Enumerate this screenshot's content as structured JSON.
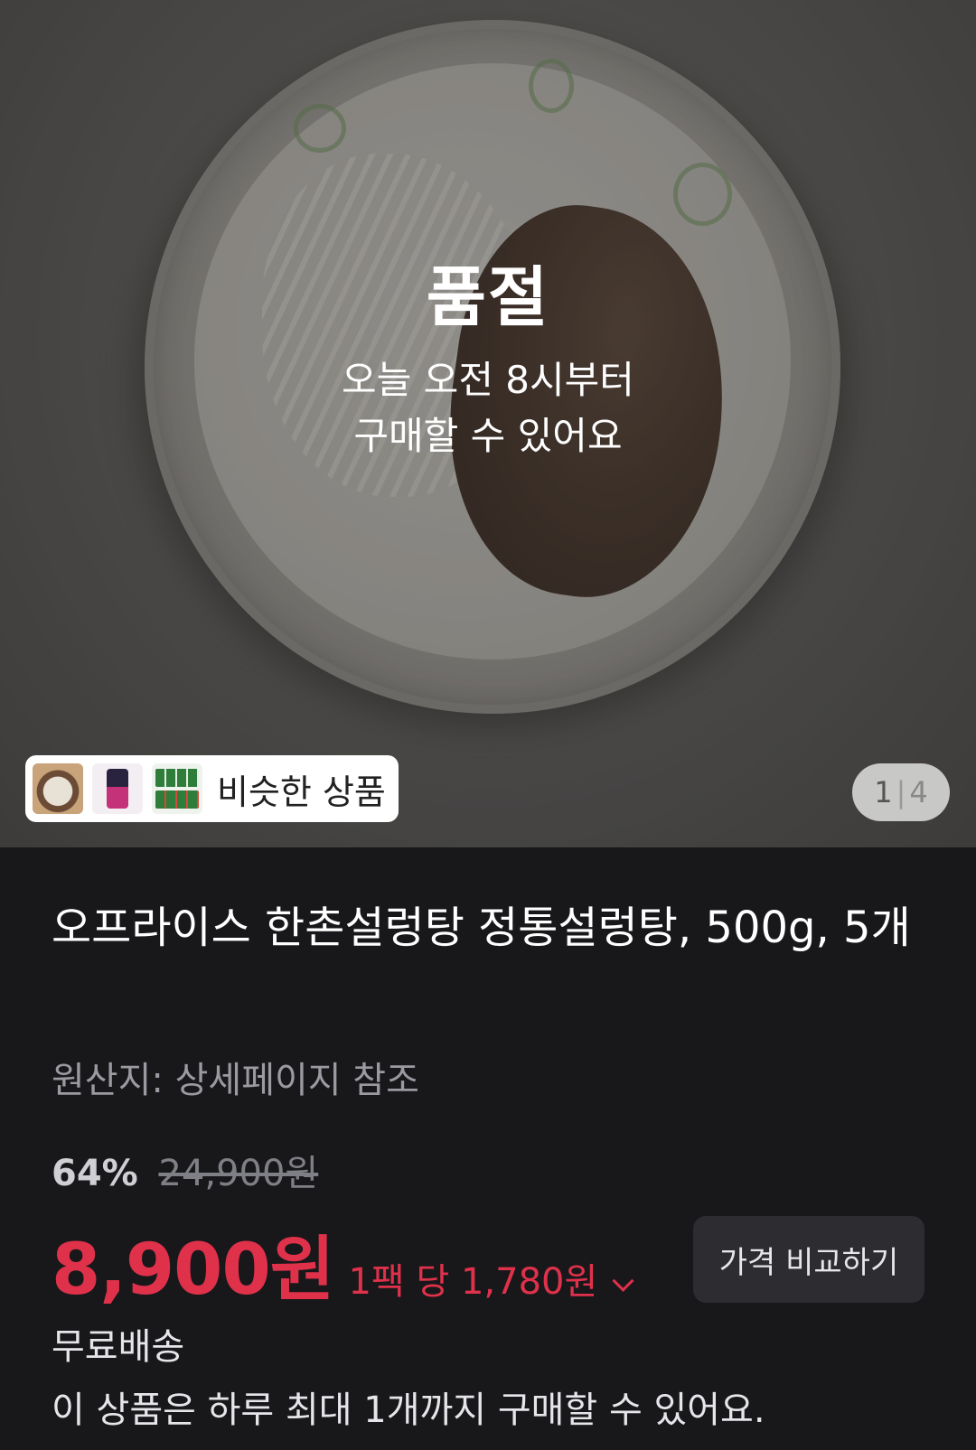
{
  "hero": {
    "status_title": "품절",
    "status_line1": "오늘 오전 8시부터",
    "status_line2": "구매할 수 있어요",
    "similar_label": "비슷한 상품",
    "image_index": "1",
    "image_total": "4"
  },
  "product": {
    "title": "오프라이스 한촌설렁탕 정통설렁탕, 500g, 5개",
    "origin": "원산지: 상세페이지 참조",
    "discount": "64%",
    "original_price": "24,900원",
    "price": "8,900원",
    "unit_price": "1팩 당 1,780원",
    "compare_button": "가격 비교하기",
    "shipping": "무료배송",
    "purchase_limit": "이 상품은 하루 최대 1개까지 구매할 수 있어요."
  },
  "colors": {
    "background": "#18181b",
    "price_accent": "#e0314b"
  }
}
